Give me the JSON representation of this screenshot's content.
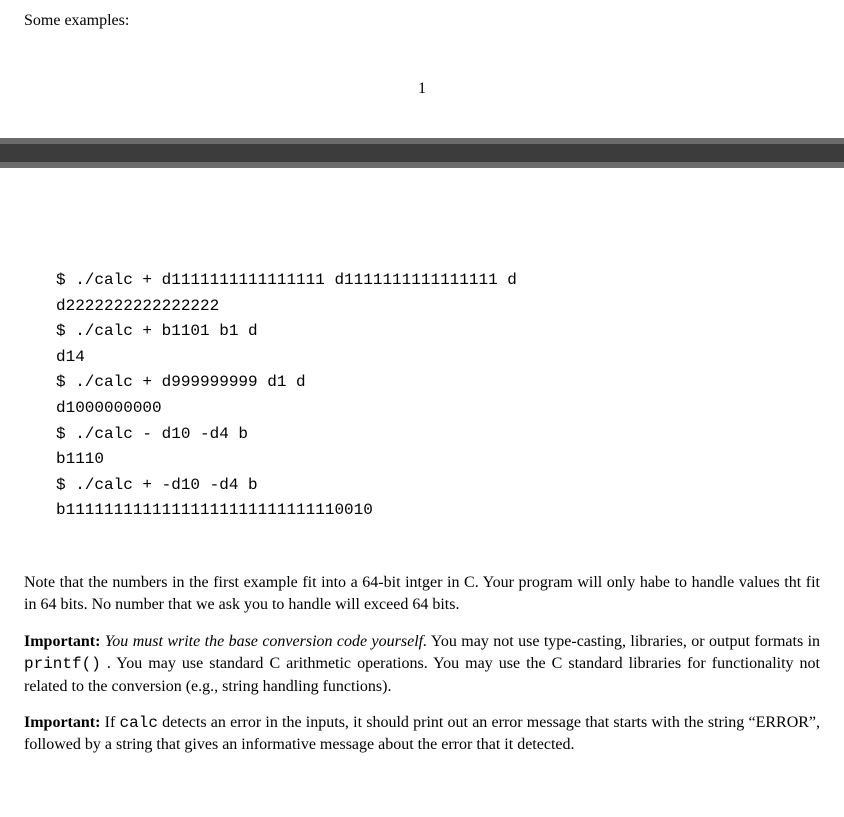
{
  "intro": "Some examples:",
  "page_number": "1",
  "code": {
    "lines": [
      "$ ./calc + d1111111111111111 d1111111111111111 d",
      "d2222222222222222",
      "$ ./calc + b1101 b1 d",
      "d14",
      "$ ./calc + d999999999 d1 d",
      "d1000000000",
      "$ ./calc - d10 -d4 b",
      "b1110",
      "$ ./calc + -d10 -d4 b",
      "b11111111111111111111111111110010"
    ]
  },
  "para1": "Note that the numbers in the first example fit into a 64-bit intger in C. Your program will only habe to handle values tht fit in 64 bits. No number that we ask you to handle will exceed 64 bits.",
  "para2": {
    "label": "Important:",
    "italic": "You must write the base conversion code yourself.",
    "rest_a": " You may not use type-casting, libraries, or output formats in ",
    "printf": "printf()",
    "rest_b": ". You may use standard C arithmetic operations. You may use the C standard libraries for functionality not related to the conversion (e.g., string handling functions)."
  },
  "para3": {
    "label": "Important:",
    "rest_a": " If ",
    "calc": "calc",
    "rest_b": " detects an error in the inputs, it should print out an error message that starts with the string “ERROR”, followed by a string that gives an informative message about the error that it detected."
  }
}
